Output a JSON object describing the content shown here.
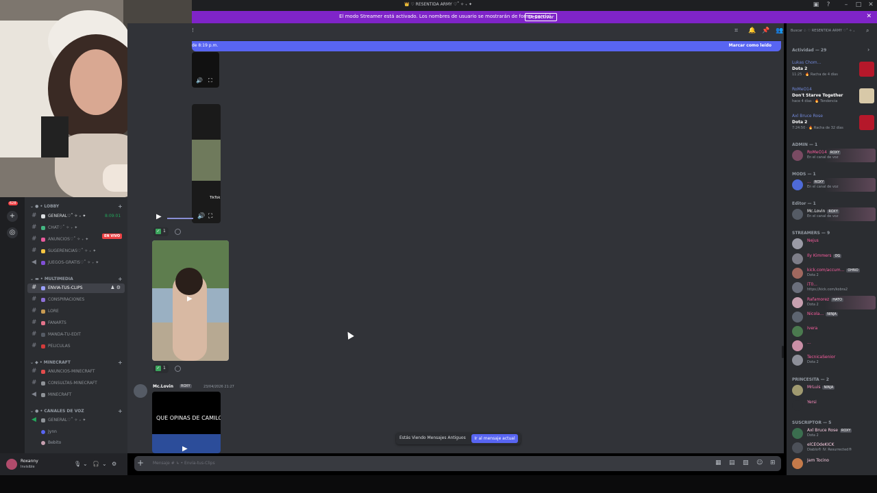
{
  "titlebar": {
    "title": "👑 ♡ RESENTIDA ARMY ♡˚ ✧ ₊ ✦"
  },
  "banner": {
    "text": "El modo Streamer está activado. Los nombres de usuario se mostrarán de forma parcial.",
    "button": "Desactivar"
  },
  "rail": {
    "badge": "628"
  },
  "sidebar": {
    "categories": {
      "lobby": "LOBBY",
      "multimedia": "MULTIMEDIA",
      "minecraft": "MINECRAFT",
      "voice": "CANALES DE VOZ"
    },
    "channels": [
      "GENERAL♡˚ ✧ ₊ ✦",
      "CHAT♡˚ ✧ ₊ ✦",
      "ANUNCIOS♡˚ ✧ ₊ ✦",
      "SUGERENCIAS♡˚ ✧ ₊ ✦",
      "JUEGOS-GRATIS♡˚ ✧ ₊ ✦",
      "ENVIA-TUS-CLIPS",
      "CONSPIRACIONES",
      "LORE",
      "FANARTS",
      "MANDA-TU-EDIT",
      "PELICULAS",
      "ANUNCIOS-MINECRAFT",
      "CONSULTAS-MINECRAFT",
      "MINECRAFT",
      "GENERAL♡˚ ✧ ₊ ✦"
    ],
    "voice_timer": "8:09:01",
    "live_badge": "EN VIVO",
    "voice_users": [
      "Jynn",
      "Bebito"
    ]
  },
  "userpanel": {
    "name": "Roxanny",
    "status": "Invisible"
  },
  "newbar": {
    "left": "de 8:19 p.m.",
    "right": "Marcar como leído"
  },
  "messages": {
    "reaction_count": "1",
    "author": "Mc.Lovin",
    "tag": "ROXY",
    "timestamp": "23/04/2026 21:27",
    "thumb_title": "QUE OPINAS DE CAMILO?",
    "tiktok": "TikTok"
  },
  "old_messages": {
    "label": "Estás Viendo Mensajes Antiguos",
    "button": "Ir al mensaje actual"
  },
  "composer": {
    "placeholder": "Mensaje #  ↳ • Envia-tus-Clips"
  },
  "members": {
    "search": "Buscar ♤ ♡ RESENTIDA ARMY ♡˚ ✧ ₊",
    "activity_header": "Actividad — 29",
    "activities": [
      {
        "who": "Lukas Chom...",
        "game": "Dota 2",
        "meta": "11:25 · 🔥 Racha de 4 días",
        "color": "#b5182a"
      },
      {
        "who": "RoMeO14",
        "game": "Don't Starve Together",
        "meta": "hace 4 días · 🔥 Tendencia",
        "color": "#d8c9a8"
      },
      {
        "who": "Axl Bruce Rose",
        "game": "Dota 2",
        "meta": "7:24:50 · 🔥 Racha de 32 días",
        "color": "#b5182a"
      }
    ],
    "sections": {
      "admin": "ADMIN — 1",
      "mods": "MODS — 1",
      "editor": "Editor — 1",
      "streamers": "STREAMERS — 9",
      "princesita": "PRINCESITA — 2",
      "suscriptor": "SUSCRIPTOR — 5"
    },
    "list": [
      {
        "name": "RoMeO14",
        "tag": "ROXY",
        "sub": "En el canal de voz",
        "color": "#ff5fa2",
        "av": "#7a4b63"
      },
      {
        "name": "...",
        "tag": "ROXY",
        "sub": "En el canal de voz",
        "color": "#ff5fa2",
        "av": "#4e6ad8"
      },
      {
        "name": "Mc.Lovin",
        "tag": "ROXY",
        "sub": "En el canal de voz",
        "color": "#ffffff",
        "av": "#555b65"
      },
      {
        "name": "Nejus",
        "tag": "",
        "sub": "",
        "color": "#ff5fa2",
        "av": "#9a9aa5"
      },
      {
        "name": "Ily Kimmers",
        "tag": "OG",
        "sub": "",
        "color": "#ff5fa2",
        "av": "#7d7d88"
      },
      {
        "name": "kick.com/accum...",
        "tag": "OHNO",
        "sub": "Dota 2",
        "color": "#ff5fa2",
        "av": "#a0685f"
      },
      {
        "name": "iT0...",
        "tag": "",
        "sub": "https://kick.com/kobra2",
        "color": "#ff5fa2",
        "av": "#6b6f7c"
      },
      {
        "name": "Rafamorez",
        "tag": "HATO",
        "sub": "Dota 2",
        "color": "#ff5fa2",
        "av": "#c7a0b0"
      },
      {
        "name": "Nicola...",
        "tag": "NINJA",
        "sub": "",
        "color": "#ff5fa2",
        "av": "#5d6470"
      },
      {
        "name": "Ivera",
        "tag": "",
        "sub": "",
        "color": "#ff5fa2",
        "av": "#4b7a4f"
      },
      {
        "name": "...",
        "tag": "",
        "sub": "",
        "color": "#ff5fa2",
        "av": "#c98fa6"
      },
      {
        "name": "TecnicaSenior",
        "tag": "",
        "sub": "Dota 2",
        "color": "#ff5fa2",
        "av": "#8d8f99"
      },
      {
        "name": "MrLuis",
        "tag": "NINJA",
        "sub": "",
        "color": "#ff8fc2",
        "av": "#a09a70"
      },
      {
        "name": "Yersi",
        "tag": "",
        "sub": "",
        "color": "#ff8fc2",
        "av": "#2b2d31"
      },
      {
        "name": "Axl Bruce Rose",
        "tag": "ROXY",
        "sub": "Dota 2",
        "color": "#ffd1e6",
        "av": "#3b6e4f"
      },
      {
        "name": "elCEOdeKICK",
        "tag": "",
        "sub": "Diablo® IV: Resurrected®",
        "color": "#ffd1e6",
        "av": "#4c5058"
      },
      {
        "name": "Jam Tocino",
        "tag": "",
        "sub": "",
        "color": "#ffd1e6",
        "av": "#c47a4a"
      }
    ]
  }
}
